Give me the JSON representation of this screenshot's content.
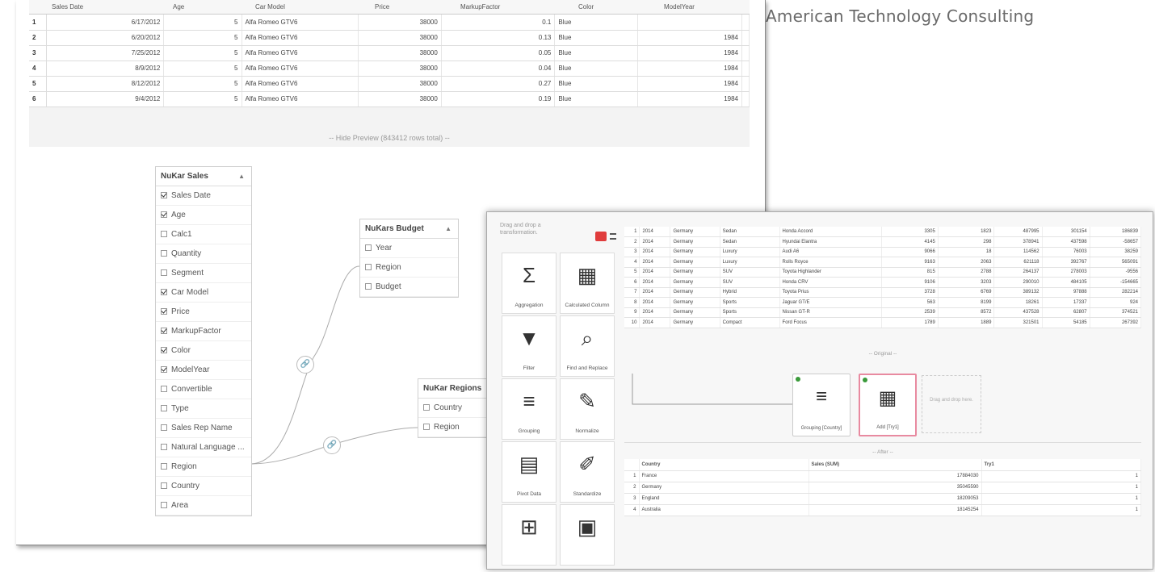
{
  "company": "American Technology Consulting",
  "preview": {
    "headers": [
      "Sales Date",
      "Age",
      "Car Model",
      "Price",
      "MarkupFactor",
      "Color",
      "ModelYear"
    ],
    "rows": [
      [
        "1",
        "6/17/2012",
        "5",
        "Alfa Romeo GTV6",
        "38000",
        "0.1",
        "Blue",
        ""
      ],
      [
        "2",
        "6/20/2012",
        "5",
        "Alfa Romeo GTV6",
        "38000",
        "0.13",
        "Blue",
        "1984"
      ],
      [
        "3",
        "7/25/2012",
        "5",
        "Alfa Romeo GTV6",
        "38000",
        "0.05",
        "Blue",
        "1984"
      ],
      [
        "4",
        "8/9/2012",
        "5",
        "Alfa Romeo GTV6",
        "38000",
        "0.04",
        "Blue",
        "1984"
      ],
      [
        "5",
        "8/12/2012",
        "5",
        "Alfa Romeo GTV6",
        "38000",
        "0.27",
        "Blue",
        "1984"
      ],
      [
        "6",
        "9/4/2012",
        "5",
        "Alfa Romeo GTV6",
        "38000",
        "0.19",
        "Blue",
        "1984"
      ]
    ],
    "hide_label": "-- Hide Preview (843412 rows total) --"
  },
  "sales": {
    "title": "NuKar Sales",
    "items": [
      {
        "label": "Sales Date",
        "checked": true
      },
      {
        "label": "Age",
        "checked": true
      },
      {
        "label": "Calc1",
        "checked": false
      },
      {
        "label": "Quantity",
        "checked": false
      },
      {
        "label": "Segment",
        "checked": false
      },
      {
        "label": "Car Model",
        "checked": true
      },
      {
        "label": "Price",
        "checked": true
      },
      {
        "label": "MarkupFactor",
        "checked": true
      },
      {
        "label": "Color",
        "checked": true
      },
      {
        "label": "ModelYear",
        "checked": true
      },
      {
        "label": "Convertible",
        "checked": false
      },
      {
        "label": "Type",
        "checked": false
      },
      {
        "label": "Sales Rep Name",
        "checked": false
      },
      {
        "label": "Natural Language ...",
        "checked": false
      },
      {
        "label": "Region",
        "checked": false
      },
      {
        "label": "Country",
        "checked": false
      },
      {
        "label": "Area",
        "checked": false
      }
    ]
  },
  "budget": {
    "title": "NuKars Budget",
    "items": [
      {
        "label": "Year"
      },
      {
        "label": "Region"
      },
      {
        "label": "Budget"
      }
    ]
  },
  "regions": {
    "title": "NuKar Regions",
    "items": [
      {
        "label": "Country"
      },
      {
        "label": "Region"
      }
    ]
  },
  "transform": {
    "hint": "Drag and drop a transformation.",
    "tiles": [
      {
        "label": "Aggregation",
        "icon": "sigma-icon",
        "glyph": "Σ"
      },
      {
        "label": "Calculated Column",
        "icon": "calculator-icon",
        "glyph": "▦"
      },
      {
        "label": "Filter",
        "icon": "filter-icon",
        "glyph": "▼"
      },
      {
        "label": "Find and Replace",
        "icon": "search-icon",
        "glyph": "⌕"
      },
      {
        "label": "Grouping",
        "icon": "grouping-icon",
        "glyph": "≡"
      },
      {
        "label": "Normalize",
        "icon": "brush-icon",
        "glyph": "✎"
      },
      {
        "label": "Pivot Data",
        "icon": "pivot-icon",
        "glyph": "▤"
      },
      {
        "label": "Standardize",
        "icon": "pencil-icon",
        "glyph": "✐"
      },
      {
        "label": "",
        "icon": "split-icon",
        "glyph": "⊞"
      },
      {
        "label": "",
        "icon": "window-icon",
        "glyph": "▣"
      }
    ],
    "original_label": "-- Original --",
    "after_label": "-- After --",
    "steps": [
      {
        "label": "Grouping [Country]",
        "icon": "grouping-icon",
        "glyph": "≡"
      },
      {
        "label": "Add [Try1]",
        "icon": "calculator-icon",
        "glyph": "▦"
      }
    ],
    "drop_label": "Drag and drop here."
  },
  "data_rows": [
    [
      "1",
      "2014",
      "Germany",
      "Sedan",
      "Honda Accord",
      "3305",
      "1823",
      "487995",
      "301154",
      "186839"
    ],
    [
      "2",
      "2014",
      "Germany",
      "Sedan",
      "Hyundai Elantra",
      "4145",
      "298",
      "378941",
      "437598",
      "-58657"
    ],
    [
      "3",
      "2014",
      "Germany",
      "Luxury",
      "Audi A6",
      "9066",
      "18",
      "114562",
      "76003",
      "38259"
    ],
    [
      "4",
      "2014",
      "Germany",
      "Luxury",
      "Rolls Royce",
      "9163",
      "2063",
      "621118",
      "392767",
      "565091"
    ],
    [
      "5",
      "2014",
      "Germany",
      "SUV",
      "Toyota Highlander",
      "815",
      "2788",
      "264137",
      "278003",
      "-9556"
    ],
    [
      "6",
      "2014",
      "Germany",
      "SUV",
      "Honda CRV",
      "9106",
      "3203",
      "290010",
      "484105",
      "-154665"
    ],
    [
      "7",
      "2014",
      "Germany",
      "Hybrid",
      "Toyota Prius",
      "3728",
      "6769",
      "389132",
      "97888",
      "282214"
    ],
    [
      "8",
      "2014",
      "Germany",
      "Sports",
      "Jaguar GT/E",
      "563",
      "8199",
      "18261",
      "17337",
      "924"
    ],
    [
      "9",
      "2014",
      "Germany",
      "Sports",
      "Nissan GT-R",
      "2539",
      "8572",
      "437528",
      "62807",
      "374521"
    ],
    [
      "10",
      "2014",
      "Germany",
      "Compact",
      "Ford Focus",
      "1789",
      "1889",
      "321501",
      "54185",
      "267392"
    ]
  ],
  "after_table": {
    "headers": [
      "Country",
      "Sales (SUM)",
      "Try1"
    ],
    "rows": [
      [
        "1",
        "France",
        "17884030",
        "1"
      ],
      [
        "2",
        "Germany",
        "35045590",
        "1"
      ],
      [
        "3",
        "England",
        "18209053",
        "1"
      ],
      [
        "4",
        "Australia",
        "18145254",
        "1"
      ]
    ]
  }
}
